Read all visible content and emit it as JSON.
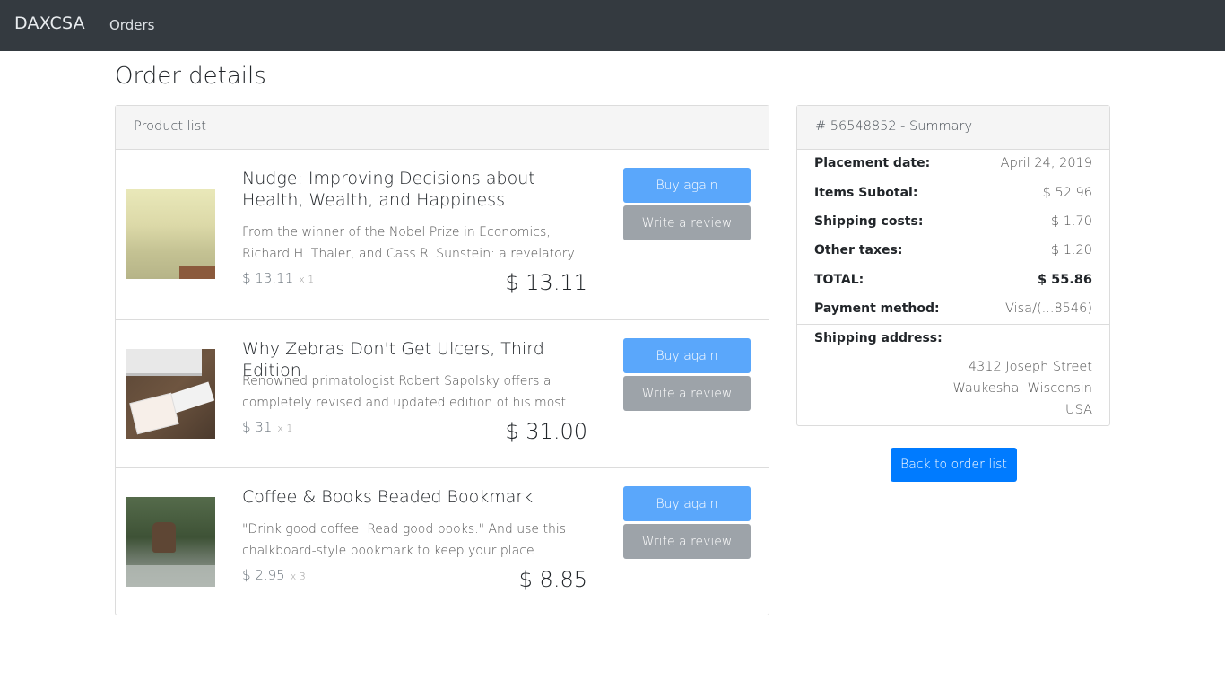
{
  "navbar": {
    "brand": "DAXCSA",
    "links": [
      "Orders"
    ]
  },
  "page": {
    "title": "Order details"
  },
  "product_list": {
    "header": "Product list",
    "buy_again_label": "Buy again",
    "write_review_label": "Write a review",
    "items": [
      {
        "title": "Nudge: Improving Decisions about Health, Wealth, and Happiness",
        "description": "From the winner of the Nobel Prize in Economics, Richard H. Thaler, and Cass R. Sunstein: a revelatory…",
        "unit_price": "$ 13.11",
        "quantity": "x 1",
        "total": "$ 13.11",
        "image": "book-cover-landscape"
      },
      {
        "title": "Why Zebras Don't Get Ulcers, Third Edition",
        "description": "Renowned primatologist Robert Sapolsky offers a completely revised and updated edition of his most…",
        "unit_price": "$ 31",
        "quantity": "x 1",
        "total": "$ 31.00",
        "image": "desk-computer-photo"
      },
      {
        "title": "Coffee & Books Beaded Bookmark",
        "description": "\"Drink good coffee. Read good books.\" And use this chalkboard-style bookmark to keep your place.",
        "unit_price": "$ 2.95",
        "quantity": "x 3",
        "total": "$ 8.85",
        "image": "deer-forest-photo"
      }
    ]
  },
  "summary": {
    "header": "# 56548852 - Summary",
    "placement_date_label": "Placement date:",
    "placement_date": "April 24, 2019",
    "items_subtotal_label": "Items Subotal:",
    "items_subtotal": "$ 52.96",
    "shipping_costs_label": "Shipping costs:",
    "shipping_costs": "$ 1.70",
    "other_taxes_label": "Other taxes:",
    "other_taxes": "$ 1.20",
    "total_label": "TOTAL:",
    "total": "$ 55.86",
    "payment_method_label": "Payment method:",
    "payment_method": "Visa/(...8546)",
    "shipping_address_label": "Shipping address:",
    "address_lines": [
      "4312 Joseph Street",
      "Waukesha, Wisconsin",
      "USA"
    ]
  },
  "back_button_label": "Back to order list",
  "colors": {
    "navbar": "#343a40",
    "primary": "#007bff",
    "buy_button": "#5aa7fb",
    "review_button": "#9da3a9"
  }
}
